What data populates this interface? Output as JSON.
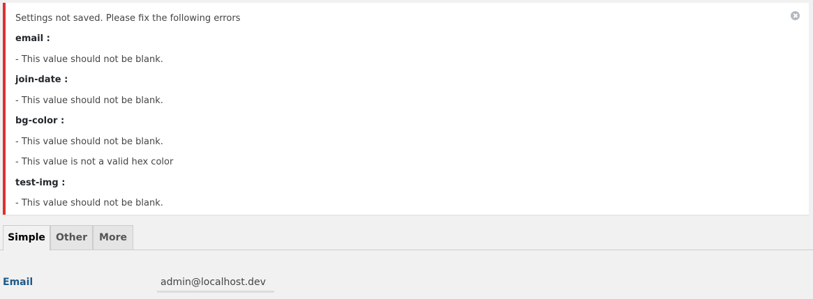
{
  "notice": {
    "title": "Settings not saved. Please fix the following errors",
    "lines": [
      {
        "text": "email :",
        "kind": "field"
      },
      {
        "text": "- This value should not be blank.",
        "kind": "error"
      },
      {
        "text": "join-date :",
        "kind": "field"
      },
      {
        "text": "- This value should not be blank.",
        "kind": "error"
      },
      {
        "text": "bg-color :",
        "kind": "field"
      },
      {
        "text": "- This value should not be blank.",
        "kind": "error"
      },
      {
        "text": "- This value is not a valid hex color",
        "kind": "error"
      },
      {
        "text": "test-img :",
        "kind": "field"
      },
      {
        "text": "- This value should not be blank.",
        "kind": "error"
      }
    ],
    "border_color": "#dc3232",
    "dismiss_icon": "dismiss-circle-icon"
  },
  "tabs": [
    {
      "label": "Simple",
      "active": true
    },
    {
      "label": "Other",
      "active": false
    },
    {
      "label": "More",
      "active": false
    }
  ],
  "form": {
    "email": {
      "label": "Email",
      "value": "admin@localhost.dev"
    }
  }
}
